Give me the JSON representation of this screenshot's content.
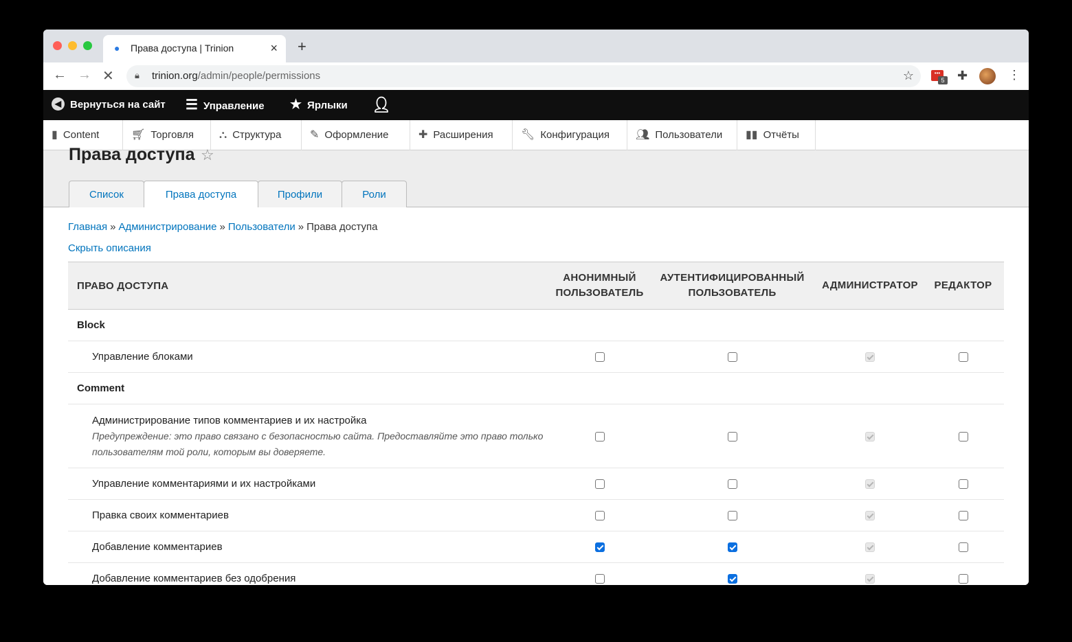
{
  "browser": {
    "tab_title": "Права доступа | Trinion",
    "url_host": "trinion.org",
    "url_path": "/admin/people/permissions",
    "extension_badge": "5"
  },
  "adminbar": {
    "back": "Вернуться на сайт",
    "manage": "Управление",
    "shortcuts": "Ярлыки"
  },
  "menu": {
    "items": [
      {
        "label": "Content",
        "icon": "document-icon"
      },
      {
        "label": "Торговля",
        "icon": "cart-icon"
      },
      {
        "label": "Структура",
        "icon": "structure-icon"
      },
      {
        "label": "Оформление",
        "icon": "brush-icon"
      },
      {
        "label": "Расширения",
        "icon": "puzzle-icon"
      },
      {
        "label": "Конфигурация",
        "icon": "wrench-icon"
      },
      {
        "label": "Пользователи",
        "icon": "users-icon"
      },
      {
        "label": "Отчёты",
        "icon": "chart-icon"
      }
    ]
  },
  "page": {
    "title": "Права доступа",
    "tabs": [
      "Список",
      "Права доступа",
      "Профили",
      "Роли"
    ],
    "active_tab": 1
  },
  "breadcrumb": {
    "items": [
      "Главная",
      "Администрирование",
      "Пользователи"
    ],
    "current": "Права доступа",
    "separator": "»"
  },
  "hide_descriptions": "Скрыть описания",
  "table": {
    "headers": {
      "name": "Право доступа",
      "anon_1": "Анонимный",
      "anon_2": "пользователь",
      "auth_1": "Аутентифицированный",
      "auth_2": "пользователь",
      "admin": "Администратор",
      "editor": "Редактор"
    },
    "modules": [
      {
        "name": "Block",
        "permissions": [
          {
            "title": "Управление блоками",
            "warning": "",
            "anon": false,
            "auth": false,
            "editor": false
          }
        ]
      },
      {
        "name": "Comment",
        "permissions": [
          {
            "title": "Администрирование типов комментариев и их настройка",
            "warning": "Предупреждение: это право связано с безопасностью сайта. Предоставляйте это право только пользователям той роли, которым вы доверяете.",
            "anon": false,
            "auth": false,
            "editor": false
          },
          {
            "title": "Управление комментариями и их настройками",
            "warning": "",
            "anon": false,
            "auth": false,
            "editor": false
          },
          {
            "title": "Правка своих комментариев",
            "warning": "",
            "anon": false,
            "auth": false,
            "editor": false
          },
          {
            "title": "Добавление комментариев",
            "warning": "",
            "anon": true,
            "auth": true,
            "editor": false
          },
          {
            "title": "Добавление комментариев без одобрения",
            "warning": "",
            "anon": false,
            "auth": true,
            "editor": false
          }
        ]
      }
    ]
  }
}
